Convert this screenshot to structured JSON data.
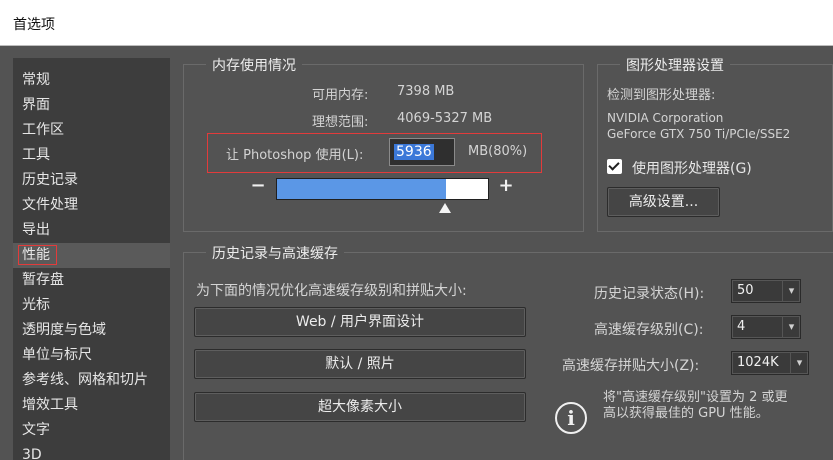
{
  "window": {
    "title": "首选项"
  },
  "sidebar": {
    "items": [
      {
        "label": "常规"
      },
      {
        "label": "界面"
      },
      {
        "label": "工作区"
      },
      {
        "label": "工具"
      },
      {
        "label": "历史记录"
      },
      {
        "label": "文件处理"
      },
      {
        "label": "导出"
      },
      {
        "label": "性能"
      },
      {
        "label": "暂存盘"
      },
      {
        "label": "光标"
      },
      {
        "label": "透明度与色域"
      },
      {
        "label": "单位与标尺"
      },
      {
        "label": "参考线、网格和切片"
      },
      {
        "label": "增效工具"
      },
      {
        "label": "文字"
      },
      {
        "label": "3D"
      }
    ],
    "active_index": 7
  },
  "memory": {
    "title": "内存使用情况",
    "available_label": "可用内存:",
    "available_value": "7398 MB",
    "ideal_label": "理想范围:",
    "ideal_value": "4069-5327 MB",
    "let_label": "让 Photoshop 使用(L):",
    "input_value": "5936",
    "unit_percent": "MB(80%)",
    "slider_percent": 80,
    "minus": "−",
    "plus": "+"
  },
  "gpu": {
    "title": "图形处理器设置",
    "detected_label": "检测到图形处理器:",
    "vendor": "NVIDIA Corporation",
    "model": "GeForce GTX 750 Ti/PCIe/SSE2",
    "use_gpu_label": "使用图形处理器(G)",
    "use_gpu_checked": true,
    "advanced_button": "高级设置..."
  },
  "history_cache": {
    "title": "历史记录与高速缓存",
    "optimize_label": "为下面的情况优化高速缓存级别和拼贴大小:",
    "buttons": [
      "Web / 用户界面设计",
      "默认 / 照片",
      "超大像素大小"
    ],
    "history_states_label": "历史记录状态(H):",
    "history_states_value": "50",
    "cache_levels_label": "高速缓存级别(C):",
    "cache_levels_value": "4",
    "tile_size_label": "高速缓存拼贴大小(Z):",
    "tile_size_value": "1024K",
    "note_line1": "将\"高速缓存级别\"设置为 2 或更",
    "note_line2": "高以获得最佳的 GPU 性能。"
  }
}
